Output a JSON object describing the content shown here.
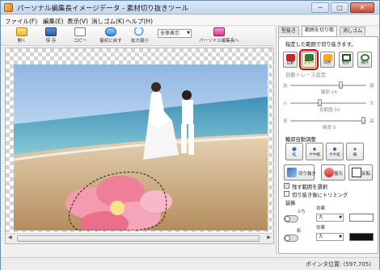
{
  "window": {
    "title": "パーソナル編集長イメージデータ - 素材切り抜きツール",
    "minimize": "─",
    "maximize": "□",
    "close": "✕"
  },
  "menu": {
    "items": [
      "ファイル(F)",
      "編集(E)",
      "表示(V)",
      "消しゴム(K)",
      "ヘルプ(H)"
    ]
  },
  "toolbar": {
    "open": "開く",
    "save": "保 存",
    "copy": "コピー",
    "reset": "最初に戻す",
    "zoom": "拡大縮小",
    "view_select": "全体表示",
    "send": "パーソナル編集長へ"
  },
  "panel": {
    "tabs": [
      "型抜き",
      "範囲を切り取",
      "消しゴム"
    ],
    "instruction": "指定した範囲で切り抜きます。",
    "modes": [
      {
        "label": "自動",
        "icon": "magnet-icon",
        "color": "#c62828"
      },
      {
        "label": "フリー",
        "icon": "lasso-icon",
        "color": "#2e7d32"
      },
      {
        "label": "同色",
        "icon": "same-color-icon",
        "color": "#f9a825"
      },
      {
        "label": "矩形",
        "icon": "rectangle-icon",
        "color": "#1b5e20"
      },
      {
        "label": "楕円",
        "icon": "ellipse-icon",
        "color": "#2e7d32"
      }
    ],
    "auto_trace": "自動トレース設定",
    "strength_label": "強",
    "weak_label": "弱",
    "edge_label": "輪郭:16",
    "small_label": "小",
    "large_label": "大",
    "color_label": "色範囲:10",
    "low_label": "低",
    "high_label": "高",
    "precision_label": "精度:0",
    "fine_adjust": "輪郭自動調整",
    "adjust_buttons": [
      "拡",
      "やや縮",
      "やや拡",
      "縮"
    ],
    "cut_button": "切り抜き",
    "undo_button": "復元",
    "invert_button": "反転",
    "keep_range": "残す範囲を選択",
    "trim_after": "切り抜き後にトリミング",
    "decor": "装飾",
    "fuchi_label": "ふち",
    "kage_label": "影",
    "effect_label": "効果",
    "effect1_value": "大",
    "effect2_value": "大",
    "swatch1_color": "#ffffff",
    "swatch2_color": "#111111"
  },
  "status": {
    "pointer": "ポインタ位置: (597,705)"
  }
}
